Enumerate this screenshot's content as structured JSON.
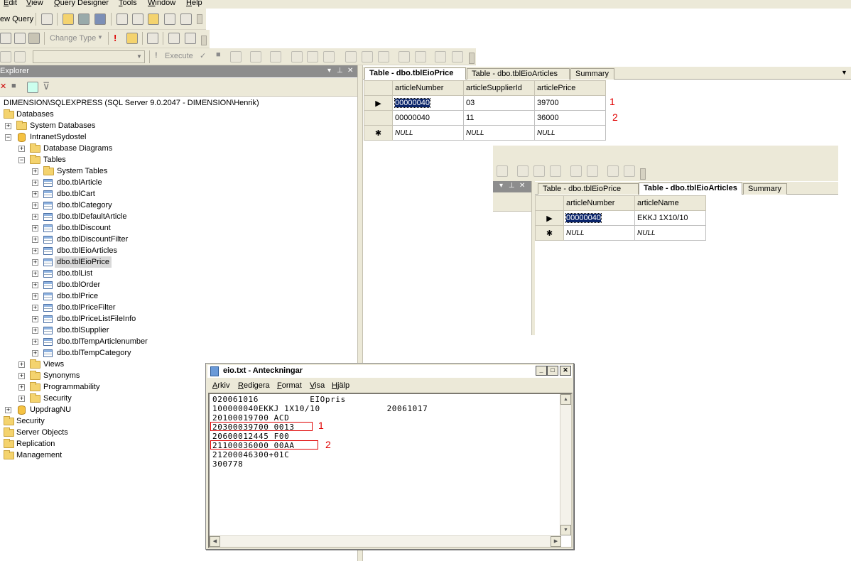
{
  "menu": [
    "Edit",
    "View",
    "Query Designer",
    "Tools",
    "Window",
    "Help"
  ],
  "toolbar": {
    "new_query": "ew Query",
    "change_type": "Change Type",
    "execute": "Execute"
  },
  "explorer": {
    "title": "Explorer",
    "server": "DIMENSION\\SQLEXPRESS (SQL Server 9.0.2047 - DIMENSION\\Henrik)",
    "nodes": {
      "databases": "Databases",
      "system_databases": "System Databases",
      "db": "IntranetSydostel",
      "diagrams": "Database Diagrams",
      "tables": "Tables",
      "system_tables": "System Tables",
      "views": "Views",
      "synonyms": "Synonyms",
      "programmability": "Programmability",
      "security_db": "Security",
      "uppdrag": "UppdragNU",
      "security": "Security",
      "server_objects": "Server Objects",
      "replication": "Replication",
      "management": "Management"
    },
    "tables": [
      "dbo.tblArticle",
      "dbo.tblCart",
      "dbo.tblCategory",
      "dbo.tblDefaultArticle",
      "dbo.tblDiscount",
      "dbo.tblDiscountFilter",
      "dbo.tblEioArticles",
      "dbo.tblEioPrice",
      "dbo.tblList",
      "dbo.tblOrder",
      "dbo.tblPrice",
      "dbo.tblPriceFilter",
      "dbo.tblPriceListFileInfo",
      "dbo.tblSupplier",
      "dbo.tblTempArticlenumber",
      "dbo.tblTempCategory"
    ]
  },
  "doc1": {
    "tabs": [
      "Table - dbo.tblEioPrice",
      "Table - dbo.tblEioArticles",
      "Summary"
    ],
    "columns": [
      "articleNumber",
      "articleSupplierId",
      "articlePrice"
    ],
    "rows": [
      [
        "00000040",
        "03",
        "39700"
      ],
      [
        "00000040",
        "11",
        "36000"
      ]
    ],
    "null_row": [
      "NULL",
      "NULL",
      "NULL"
    ],
    "markers": [
      "1",
      "2"
    ]
  },
  "doc2": {
    "tabs": [
      "Table - dbo.tblEioPrice",
      "Table - dbo.tblEioArticles",
      "Summary"
    ],
    "columns": [
      "articleNumber",
      "articleName"
    ],
    "rows": [
      [
        "00000040",
        "EKKJ 1X10/10"
      ]
    ],
    "null_row": [
      "NULL",
      "NULL"
    ]
  },
  "notepad": {
    "title": "eio.txt - Anteckningar",
    "menu": [
      "Arkiv",
      "Redigera",
      "Format",
      "Visa",
      "Hjälp"
    ],
    "lines": [
      "020061016          EIOpris",
      "100000040EKKJ 1X10/10             20061017",
      "20100019700 ACD",
      "20300039700 0013",
      "20600012445 F00",
      "21100036000 00AA",
      "21200046300+01C",
      "300778"
    ],
    "markers": [
      "1",
      "2"
    ]
  }
}
